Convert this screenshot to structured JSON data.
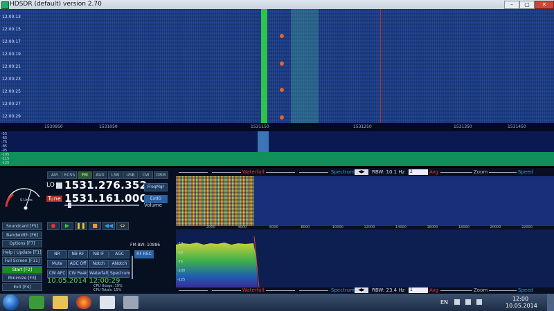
{
  "window": {
    "title": "HDSDR (default)  version 2.70"
  },
  "waterfall": {
    "time_labels": [
      "12:00:13",
      "12:00:15",
      "12:00:17",
      "12:00:19",
      "12:00:21",
      "12:00:23",
      "12:00:25",
      "12:00:27",
      "12:00:29"
    ],
    "freq_labels": [
      "1530950",
      "1531050",
      "1531150",
      "1531250",
      "1531350",
      "1531450"
    ]
  },
  "spectrum_strip": {
    "db_labels": [
      "-55",
      "-65",
      "-75",
      "-85",
      "-95",
      "-105",
      "-115",
      "-125"
    ]
  },
  "radio": {
    "mode_buttons": [
      "AM",
      "ECSS",
      "FM",
      "AUX",
      "LSB",
      "USB",
      "CW",
      "DRM"
    ],
    "active_mode": "FM",
    "lo_label": "LO",
    "lo_value": "1531.276.352",
    "tune_label": "Tune",
    "tune_value": "1531.161.000",
    "volume_label": "Volume",
    "freq_mgr": "FreqMgr",
    "extio": "ExtIO",
    "s_units": "S-Units"
  },
  "side_buttons": [
    {
      "label": "Soundcard   [F5]",
      "green": false
    },
    {
      "label": "Bandwidth   [F6]",
      "green": false
    },
    {
      "label": "Options     [F7]",
      "green": false
    },
    {
      "label": "Help / Update [F1]",
      "green": false
    },
    {
      "label": "Full Screen [F11]",
      "green": false
    },
    {
      "label": "Start      [F2]",
      "green": true
    },
    {
      "label": "Minimize    [F3]",
      "green": false
    },
    {
      "label": "Exit       [F4]",
      "green": false
    }
  ],
  "transport": [
    "●",
    "▶",
    "❚❚",
    "■",
    "◀◀",
    "⇔"
  ],
  "dsp_rows": [
    [
      "NR",
      "NB RF",
      "NB IF",
      "AGC"
    ],
    [
      "Mute",
      "AGC Off",
      "Notch",
      "ANotch"
    ],
    [
      "CW AFC",
      "CW Peak",
      "Waterfall",
      "Spectrum"
    ]
  ],
  "fm_bw": "FM-BW: 10886",
  "rec_button": "RF REC",
  "datetime": "10.05.2014 12:00:29",
  "cpu_lines": [
    "CPU Usage: 19%",
    "CPU Totals: 15%"
  ],
  "controls_top": {
    "waterfall": "Waterfall",
    "spectrum": "Spectrum",
    "rbw": "RBW: 10.1 Hz",
    "rbw_sel": "2",
    "avg": "Avg",
    "zoom": "Zoom",
    "speed": "Speed"
  },
  "controls_bottom": {
    "waterfall": "Waterfall",
    "spectrum": "Spectrum",
    "rbw": "RBW: 23.4 Hz",
    "rbw_sel": "1",
    "avg": "Avg",
    "zoom": "Zoom",
    "speed": "Speed"
  },
  "af_freq_labels": [
    "2000",
    "4000",
    "6000",
    "8000",
    "10000",
    "12000",
    "14000",
    "16000",
    "18000",
    "20000",
    "22000"
  ],
  "af_db_labels": [
    "-10",
    "-50",
    "-75",
    "-100",
    "-125"
  ],
  "taskbar": {
    "lang": "EN",
    "time": "12:00",
    "date": "10.05.2014"
  }
}
